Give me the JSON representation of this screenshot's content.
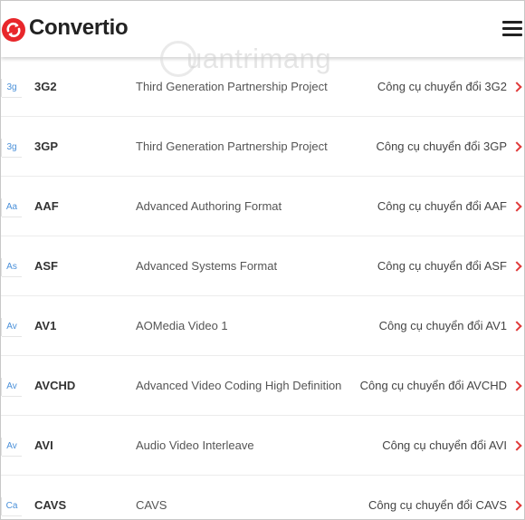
{
  "header": {
    "logo_text": "Convertio",
    "brand_color": "#e8272b",
    "menu_icon": "hamburger-icon"
  },
  "watermark": {
    "text": "uantrimang"
  },
  "formats": [
    {
      "icon": "3g",
      "name": "3G2",
      "description": "Third Generation Partnership Project",
      "link": "Công cụ chuyển đổi 3G2"
    },
    {
      "icon": "3g",
      "name": "3GP",
      "description": "Third Generation Partnership Project",
      "link": "Công cụ chuyển đổi 3GP"
    },
    {
      "icon": "Aa",
      "name": "AAF",
      "description": "Advanced Authoring Format",
      "link": "Công cụ chuyển đổi AAF"
    },
    {
      "icon": "As",
      "name": "ASF",
      "description": "Advanced Systems Format",
      "link": "Công cụ chuyển đổi ASF"
    },
    {
      "icon": "Av",
      "name": "AV1",
      "description": "AOMedia Video 1",
      "link": "Công cụ chuyển đổi AV1"
    },
    {
      "icon": "Av",
      "name": "AVCHD",
      "description": "Advanced Video Coding High Definition",
      "link": "Công cụ chuyển đổi AVCHD"
    },
    {
      "icon": "Av",
      "name": "AVI",
      "description": "Audio Video Interleave",
      "link": "Công cụ chuyển đổi AVI"
    },
    {
      "icon": "Ca",
      "name": "CAVS",
      "description": "CAVS",
      "link": "Công cụ chuyển đổi CAVS"
    }
  ]
}
